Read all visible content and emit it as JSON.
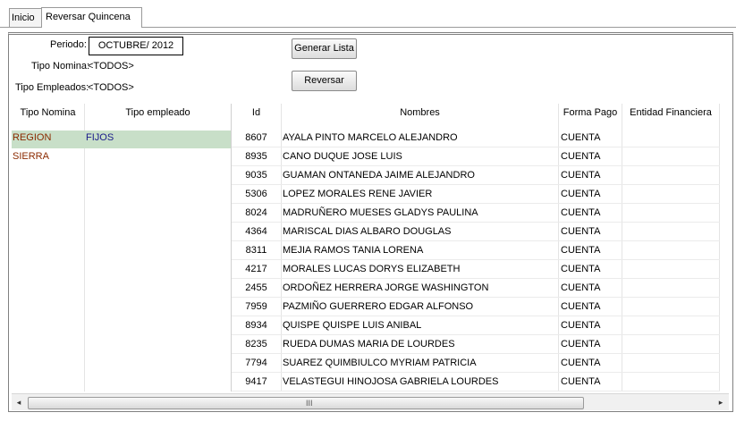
{
  "tabs": [
    "Inicio",
    "Reversar Quincena"
  ],
  "form": {
    "periodo_label": "Periodo:",
    "periodo_value": "OCTUBRE/ 2012",
    "tipo_nomina_label": "Tipo Nomina:",
    "tipo_nomina_value": "<TODOS>",
    "tipo_empleados_label": "Tipo Empleados:",
    "tipo_empleados_value": "<TODOS>"
  },
  "buttons": {
    "generar": "Generar Lista",
    "reversar": "Reversar"
  },
  "left_table": {
    "headers": [
      "Tipo Nomina",
      "Tipo empleado"
    ],
    "rows": [
      [
        "REGION SIERRA",
        "FIJOS"
      ]
    ]
  },
  "right_table": {
    "headers": [
      "Id",
      "Nombres",
      "Forma Pago",
      "Entidad Financiera"
    ],
    "rows": [
      [
        "8607",
        "AYALA PINTO MARCELO ALEJANDRO",
        "CUENTA"
      ],
      [
        "8935",
        "CANO DUQUE JOSE LUIS",
        "CUENTA"
      ],
      [
        "9035",
        "GUAMAN ONTANEDA JAIME ALEJANDRO",
        "CUENTA"
      ],
      [
        "5306",
        "LOPEZ MORALES RENE JAVIER",
        "CUENTA"
      ],
      [
        "8024",
        "MADRUÑERO MUESES GLADYS PAULINA",
        "CUENTA"
      ],
      [
        "4364",
        "MARISCAL DIAS ALBARO DOUGLAS",
        "CUENTA"
      ],
      [
        "8311",
        "MEJIA RAMOS TANIA LORENA",
        "CUENTA"
      ],
      [
        "4217",
        "MORALES LUCAS DORYS ELIZABETH",
        "CUENTA"
      ],
      [
        "2455",
        "ORDOÑEZ HERRERA JORGE WASHINGTON",
        "CUENTA"
      ],
      [
        "7959",
        "PAZMIÑO GUERRERO EDGAR ALFONSO",
        "CUENTA"
      ],
      [
        "8934",
        "QUISPE QUISPE LUIS ANIBAL",
        "CUENTA"
      ],
      [
        "8235",
        "RUEDA DUMAS MARIA DE LOURDES",
        "CUENTA"
      ],
      [
        "7794",
        "SUAREZ QUIMBIULCO MYRIAM PATRICIA",
        "CUENTA"
      ],
      [
        "9417",
        "VELASTEGUI HINOJOSA GABRIELA LOURDES",
        "CUENTA"
      ]
    ]
  },
  "scrollbar": {
    "left_arrow": "◂",
    "right_arrow": "▸",
    "grip": "III"
  },
  "colors": {
    "selection": "#c8dfc8",
    "nomina_text": "#8b2a00",
    "empleado_text": "#1a1a8a"
  }
}
